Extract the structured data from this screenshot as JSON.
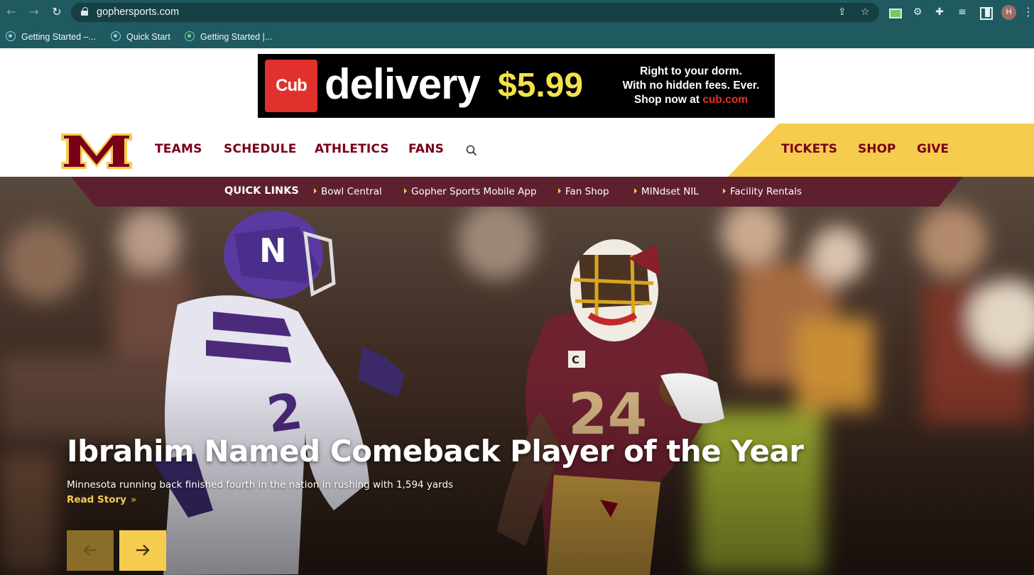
{
  "browser": {
    "url": "gophersports.com",
    "avatar_letter": "H",
    "bookmarks": [
      {
        "label": "Getting Started –..."
      },
      {
        "label": "Quick Start"
      },
      {
        "label": "Getting Started |..."
      }
    ],
    "icons": [
      "back-icon",
      "forward-icon",
      "reload-icon",
      "lock-icon",
      "share-icon",
      "star-icon",
      "extension-icon",
      "gear-icon",
      "puzzle-icon",
      "reading-list-icon",
      "side-panel-icon",
      "kebab-icon"
    ]
  },
  "ad": {
    "brand": "Cub",
    "headline": "delivery",
    "price": "$5.99",
    "line1": "Right to your dorm.",
    "line2": "With no hidden fees. Ever.",
    "line3_prefix": "Shop now at ",
    "line3_link": "cub.com"
  },
  "nav": {
    "main": [
      "TEAMS",
      "SCHEDULE",
      "ATHLETICS",
      "FANS"
    ],
    "gold": [
      "TICKETS",
      "SHOP",
      "GIVE"
    ]
  },
  "quick_links": {
    "title": "QUICK LINKS",
    "items": [
      "Bowl Central",
      "Gopher Sports Mobile App",
      "Fan Shop",
      "MINdset NIL",
      "Facility Rentals"
    ]
  },
  "hero": {
    "headline": "Ibrahim Named Comeback Player of the Year",
    "subhead": "Minnesota running back finished fourth in the nation in rushing with 1,594 yards",
    "cta": "Read Story",
    "cta_icon": "»"
  },
  "colors": {
    "maroon": "#7a0019",
    "gold": "#f6cc4f",
    "chrome": "#1e5a5f"
  }
}
